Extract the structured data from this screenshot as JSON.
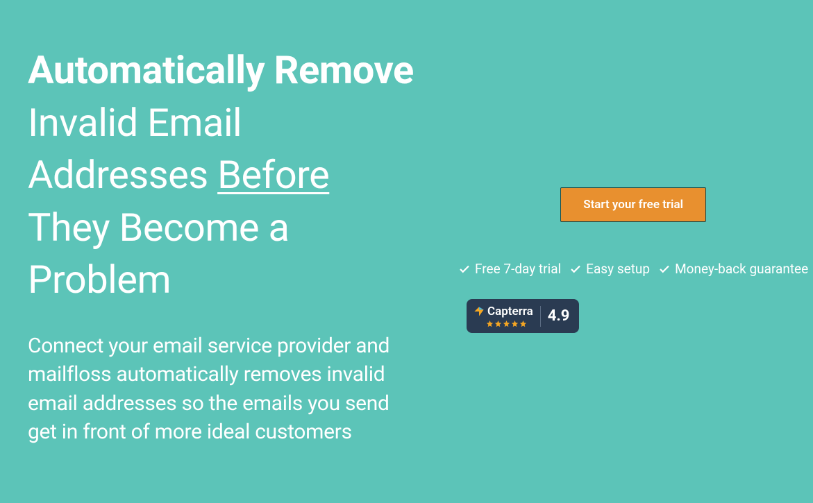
{
  "hero": {
    "headline_bold1": "Automatically Remove",
    "headline_mid1": " Invalid Email Addresses ",
    "headline_underline": "Before",
    "headline_mid2": " They Become a Problem",
    "subhead": "Connect your email service provider and mailfloss automatically removes invalid email addresses so the emails you send get in front of more ideal customers"
  },
  "cta": {
    "button_label": "Start your free trial"
  },
  "features": {
    "item1": "Free 7-day trial",
    "item2": "Easy setup",
    "item3": "Money-back guarantee"
  },
  "rating": {
    "brand": "Capterra",
    "score": "4.9",
    "stars": 5
  }
}
